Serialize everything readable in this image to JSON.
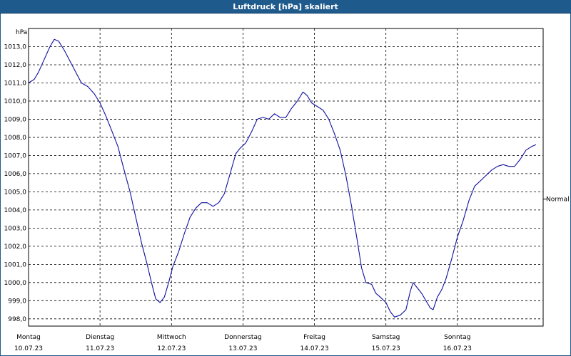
{
  "chart_data": {
    "type": "line",
    "title": "Luftdruck [hPa] skaliert",
    "ylabel": "hPa",
    "ylim": [
      997.6,
      1014.0
    ],
    "y_ticks": [
      "998,0",
      "999,0",
      "1000,0",
      "1001,0",
      "1002,0",
      "1003,0",
      "1004,0",
      "1005,0",
      "1006,0",
      "1007,0",
      "1008,0",
      "1009,0",
      "1010,0",
      "1011,0",
      "1012,0",
      "1013,0"
    ],
    "x_ticks": [
      {
        "day": "Montag",
        "date": "10.07.23"
      },
      {
        "day": "Dienstag",
        "date": "11.07.23"
      },
      {
        "day": "Mittwoch",
        "date": "12.07.23"
      },
      {
        "day": "Donnerstag",
        "date": "13.07.23"
      },
      {
        "day": "Freitag",
        "date": "14.07.23"
      },
      {
        "day": "Samstag",
        "date": "15.07.23"
      },
      {
        "day": "Sonntag",
        "date": "16.07.23"
      }
    ],
    "xlim_days": [
      0,
      7.2
    ],
    "grid": true,
    "reference_label": "Normal",
    "reference_value": 1004.6,
    "series": [
      {
        "color": "#1010a0",
        "points": [
          [
            0.0,
            1011.0
          ],
          [
            0.08,
            1011.2
          ],
          [
            0.14,
            1011.6
          ],
          [
            0.22,
            1012.3
          ],
          [
            0.3,
            1013.0
          ],
          [
            0.36,
            1013.4
          ],
          [
            0.42,
            1013.3
          ],
          [
            0.5,
            1012.8
          ],
          [
            0.58,
            1012.2
          ],
          [
            0.66,
            1011.6
          ],
          [
            0.74,
            1011.0
          ],
          [
            0.83,
            1010.8
          ],
          [
            0.92,
            1010.4
          ],
          [
            1.0,
            1009.9
          ],
          [
            1.08,
            1009.2
          ],
          [
            1.16,
            1008.4
          ],
          [
            1.25,
            1007.5
          ],
          [
            1.33,
            1006.3
          ],
          [
            1.42,
            1005.0
          ],
          [
            1.5,
            1003.6
          ],
          [
            1.58,
            1002.2
          ],
          [
            1.66,
            1001.0
          ],
          [
            1.72,
            1000.0
          ],
          [
            1.78,
            999.1
          ],
          [
            1.84,
            998.9
          ],
          [
            1.9,
            999.2
          ],
          [
            1.96,
            1000.0
          ],
          [
            2.02,
            1000.9
          ],
          [
            2.1,
            1001.7
          ],
          [
            2.18,
            1002.7
          ],
          [
            2.26,
            1003.6
          ],
          [
            2.34,
            1004.1
          ],
          [
            2.42,
            1004.4
          ],
          [
            2.5,
            1004.4
          ],
          [
            2.58,
            1004.2
          ],
          [
            2.66,
            1004.4
          ],
          [
            2.74,
            1004.9
          ],
          [
            2.82,
            1006.0
          ],
          [
            2.9,
            1007.1
          ],
          [
            2.96,
            1007.4
          ],
          [
            3.04,
            1007.7
          ],
          [
            3.12,
            1008.3
          ],
          [
            3.2,
            1009.0
          ],
          [
            3.28,
            1009.1
          ],
          [
            3.36,
            1009.0
          ],
          [
            3.44,
            1009.3
          ],
          [
            3.52,
            1009.1
          ],
          [
            3.6,
            1009.1
          ],
          [
            3.68,
            1009.6
          ],
          [
            3.76,
            1010.0
          ],
          [
            3.84,
            1010.5
          ],
          [
            3.9,
            1010.3
          ],
          [
            3.96,
            1009.9
          ],
          [
            4.04,
            1009.7
          ],
          [
            4.12,
            1009.5
          ],
          [
            4.2,
            1009.0
          ],
          [
            4.28,
            1008.2
          ],
          [
            4.36,
            1007.3
          ],
          [
            4.44,
            1005.9
          ],
          [
            4.52,
            1004.2
          ],
          [
            4.6,
            1002.3
          ],
          [
            4.66,
            1000.8
          ],
          [
            4.72,
            1000.0
          ],
          [
            4.8,
            999.9
          ],
          [
            4.86,
            999.4
          ],
          [
            4.92,
            999.2
          ],
          [
            5.0,
            998.9
          ],
          [
            5.06,
            998.4
          ],
          [
            5.12,
            998.1
          ],
          [
            5.2,
            998.2
          ],
          [
            5.28,
            998.5
          ],
          [
            5.34,
            999.5
          ],
          [
            5.38,
            1000.0
          ],
          [
            5.44,
            999.7
          ],
          [
            5.5,
            999.4
          ],
          [
            5.56,
            999.0
          ],
          [
            5.62,
            998.6
          ],
          [
            5.66,
            998.5
          ],
          [
            5.72,
            999.2
          ],
          [
            5.78,
            999.6
          ],
          [
            5.84,
            1000.2
          ],
          [
            5.92,
            1001.3
          ],
          [
            6.0,
            1002.5
          ],
          [
            6.08,
            1003.4
          ],
          [
            6.16,
            1004.5
          ],
          [
            6.24,
            1005.3
          ],
          [
            6.32,
            1005.6
          ],
          [
            6.4,
            1005.9
          ],
          [
            6.48,
            1006.2
          ],
          [
            6.56,
            1006.4
          ],
          [
            6.64,
            1006.5
          ],
          [
            6.72,
            1006.4
          ],
          [
            6.8,
            1006.4
          ],
          [
            6.88,
            1006.8
          ],
          [
            6.96,
            1007.3
          ],
          [
            7.04,
            1007.5
          ],
          [
            7.1,
            1007.6
          ]
        ]
      }
    ]
  }
}
